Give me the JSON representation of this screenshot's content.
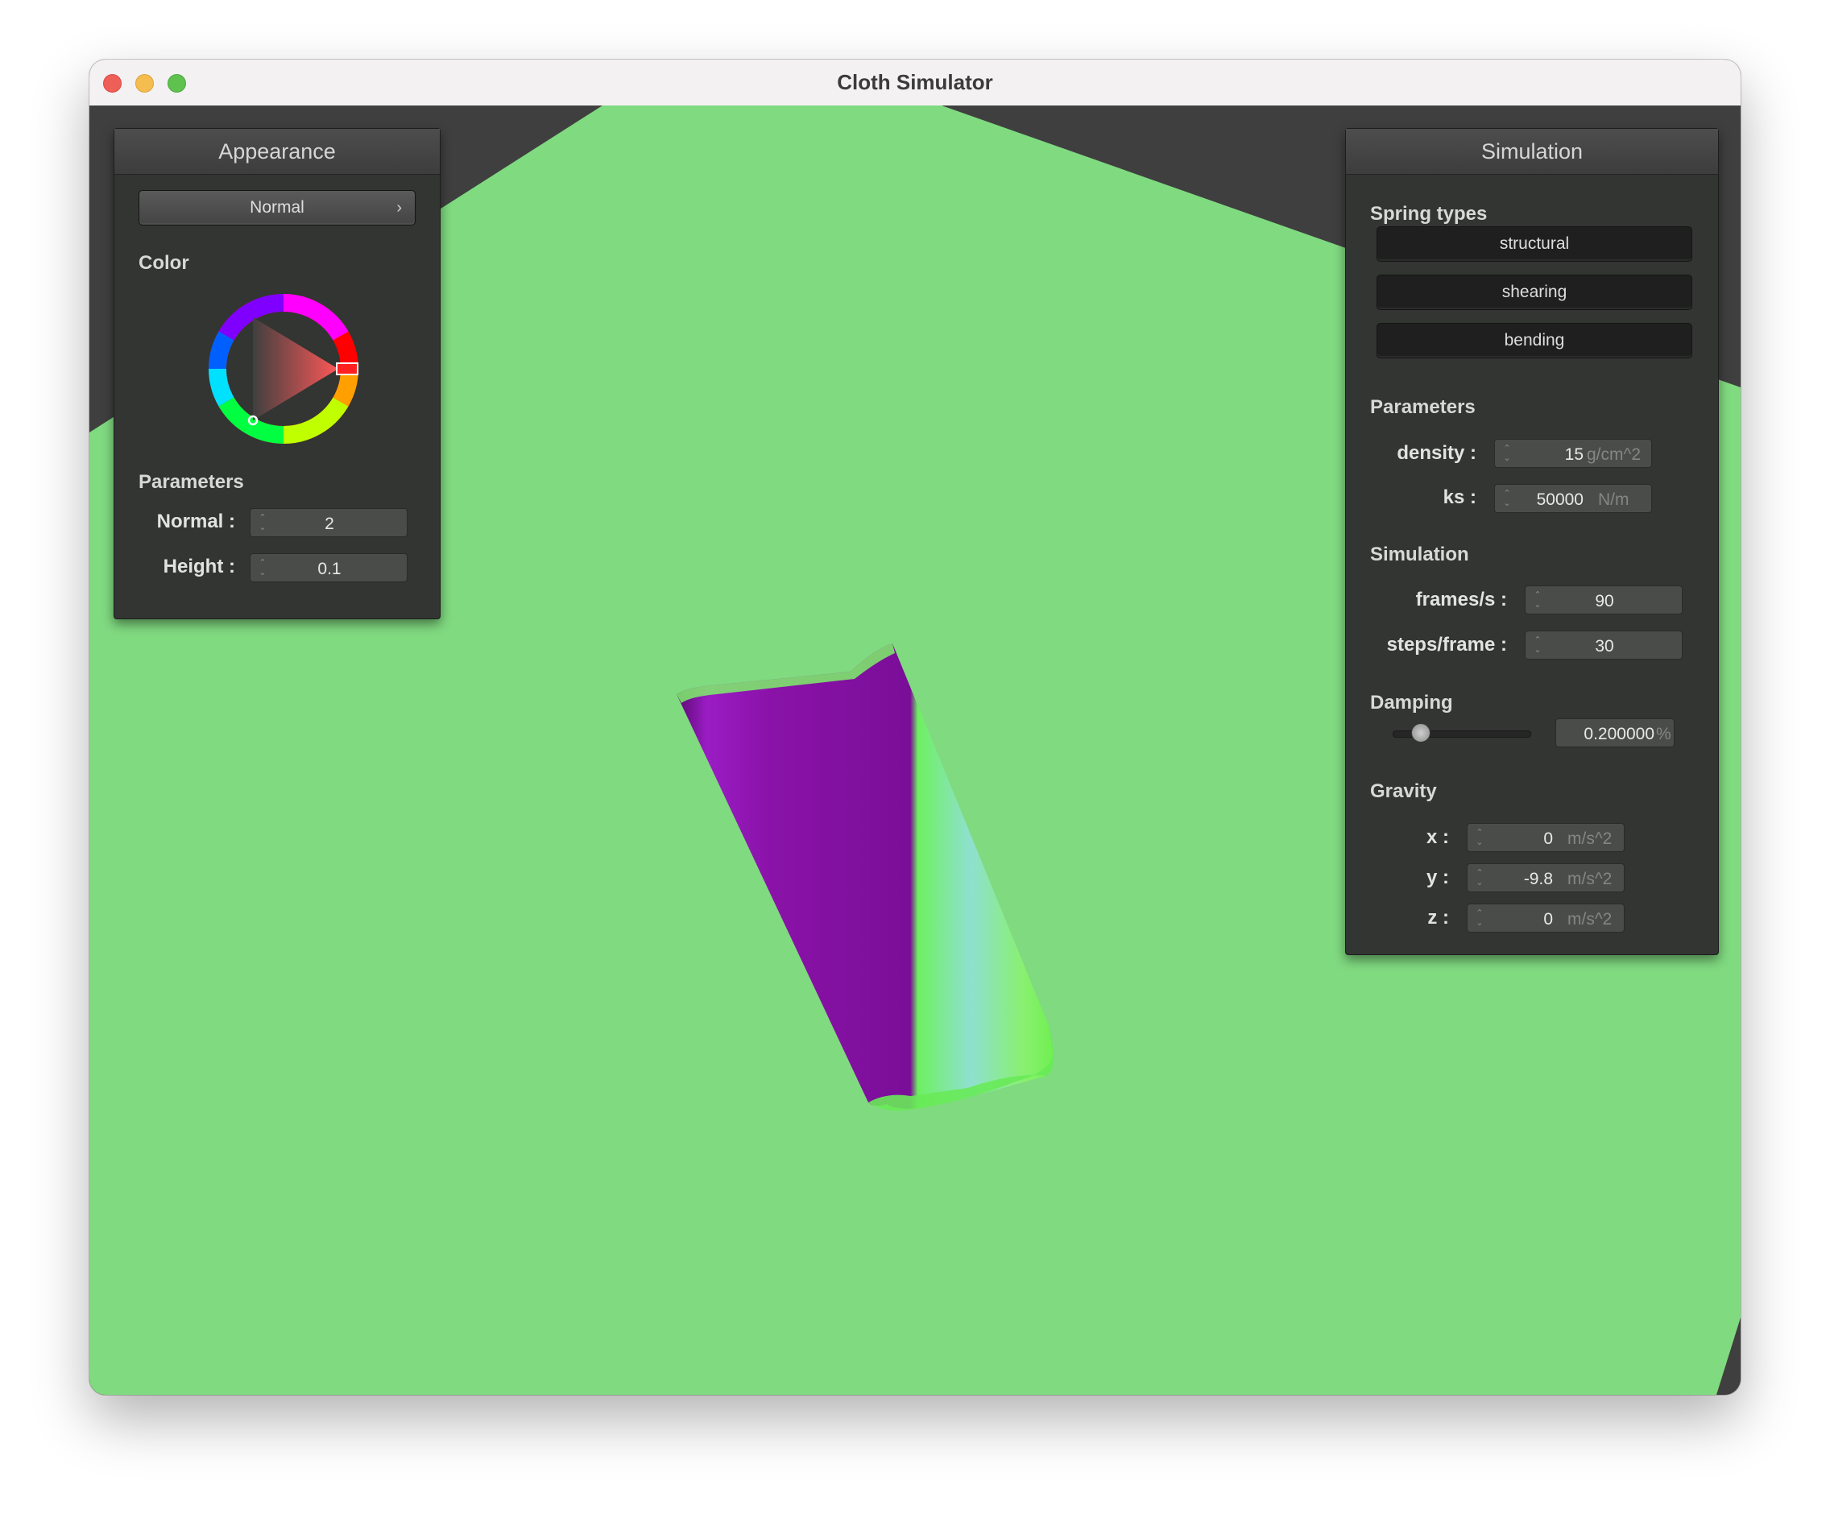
{
  "window": {
    "title": "Cloth Simulator"
  },
  "colors": {
    "ground": "#80da80",
    "background": "#3f3f3f",
    "panel": "#323532",
    "cloth_primary": "#8a12a8",
    "cloth_edge": "#7ef86a"
  },
  "appearance": {
    "title": "Appearance",
    "shader_select": {
      "value": "Normal",
      "icon": "chevron-right-icon"
    },
    "color_label": "Color",
    "color_wheel": {
      "selected_color": "#ff2020"
    },
    "parameters_label": "Parameters",
    "params": [
      {
        "label": "Normal :",
        "value": "2"
      },
      {
        "label": "Height :",
        "value": "0.1"
      }
    ]
  },
  "simulation": {
    "title": "Simulation",
    "spring_types_label": "Spring types",
    "spring_types": [
      "structural",
      "shearing",
      "bending"
    ],
    "parameters_label": "Parameters",
    "params": [
      {
        "label": "density :",
        "value": "15",
        "unit": "g/cm^2"
      },
      {
        "label": "ks :",
        "value": "50000",
        "unit": "N/m"
      }
    ],
    "simulation_label": "Simulation",
    "sim_params": [
      {
        "label": "frames/s :",
        "value": "90"
      },
      {
        "label": "steps/frame :",
        "value": "30"
      }
    ],
    "damping_label": "Damping",
    "damping": {
      "value": "0.200000",
      "unit": "%",
      "slider_fraction": 0.2
    },
    "gravity_label": "Gravity",
    "gravity": [
      {
        "label": "x :",
        "value": "0",
        "unit": "m/s^2"
      },
      {
        "label": "y :",
        "value": "-9.8",
        "unit": "m/s^2"
      },
      {
        "label": "z :",
        "value": "0",
        "unit": "m/s^2"
      }
    ]
  }
}
